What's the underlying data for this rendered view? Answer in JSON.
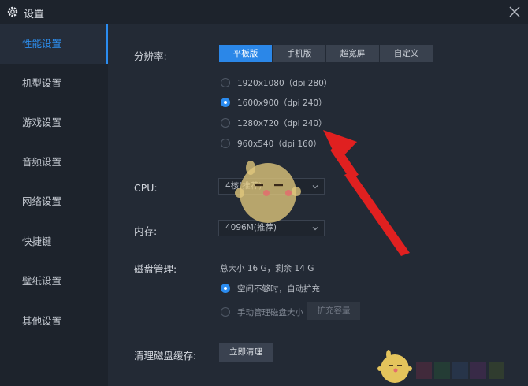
{
  "window": {
    "title": "设置"
  },
  "sidebar": {
    "items": [
      {
        "label": "性能设置",
        "active": true
      },
      {
        "label": "机型设置"
      },
      {
        "label": "游戏设置"
      },
      {
        "label": "音频设置"
      },
      {
        "label": "网络设置"
      },
      {
        "label": "快捷键"
      },
      {
        "label": "壁纸设置"
      },
      {
        "label": "其他设置"
      }
    ]
  },
  "resolution": {
    "label": "分辨率:",
    "tabs": [
      "平板版",
      "手机版",
      "超宽屏",
      "自定义"
    ],
    "active_tab": "平板版",
    "options": [
      {
        "text": "1920x1080（dpi 280）",
        "checked": false
      },
      {
        "text": "1600x900（dpi 240）",
        "checked": true
      },
      {
        "text": "1280x720（dpi 240）",
        "checked": false
      },
      {
        "text": "960x540（dpi 160）",
        "checked": false
      }
    ]
  },
  "cpu": {
    "label": "CPU:",
    "value": "4核(推荐)"
  },
  "memory": {
    "label": "内存:",
    "value": "4096M(推荐)"
  },
  "disk": {
    "label": "磁盘管理:",
    "summary": "总大小 16 G，剩余 14 G",
    "options": [
      {
        "text": "空间不够时，自动扩充",
        "checked": true
      },
      {
        "text": "手动管理磁盘大小",
        "checked": false
      }
    ],
    "expand_button": "扩充容量"
  },
  "cache": {
    "label": "清理磁盘缓存:",
    "button": "立即清理"
  },
  "colors": {
    "accent": "#2b8cf0",
    "arrow": "#e02020",
    "sidebar": "#1d232c",
    "panel": "#232a35"
  }
}
